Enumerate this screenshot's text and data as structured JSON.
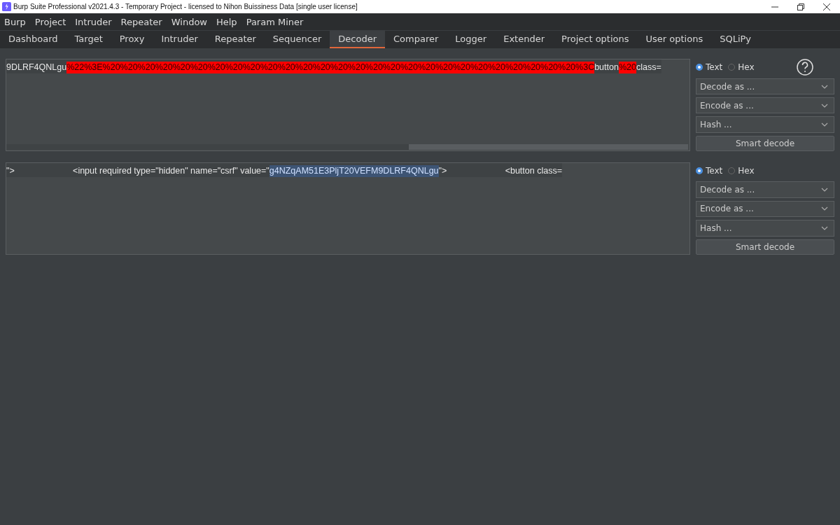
{
  "window": {
    "title": "Burp Suite Professional v2021.4.3 - Temporary Project - licensed to Nihon Buissiness Data [single user license]"
  },
  "menu": [
    "Burp",
    "Project",
    "Intruder",
    "Repeater",
    "Window",
    "Help",
    "Param Miner"
  ],
  "tabs": [
    {
      "label": "Dashboard",
      "selected": false
    },
    {
      "label": "Target",
      "selected": false
    },
    {
      "label": "Proxy",
      "selected": false
    },
    {
      "label": "Intruder",
      "selected": false
    },
    {
      "label": "Repeater",
      "selected": false
    },
    {
      "label": "Sequencer",
      "selected": false
    },
    {
      "label": "Decoder",
      "selected": true
    },
    {
      "label": "Comparer",
      "selected": false
    },
    {
      "label": "Logger",
      "selected": false
    },
    {
      "label": "Extender",
      "selected": false
    },
    {
      "label": "Project options",
      "selected": false
    },
    {
      "label": "User options",
      "selected": false
    },
    {
      "label": "SQLiPy",
      "selected": false
    }
  ],
  "panels": [
    {
      "segments": [
        {
          "text": "9DLRF4QNLgu",
          "kind": "plain"
        },
        {
          "text": "%22%3E%20%20%20%20%20%20%20%20%20%20%20%20%20%20%20%20%20%20%20%20%20%20%20%20%20%20%20%3C",
          "kind": "highlight"
        },
        {
          "text": "button",
          "kind": "plain"
        },
        {
          "text": "%20",
          "kind": "highlight"
        },
        {
          "text": "class=",
          "kind": "plain"
        }
      ],
      "scrollbar": true,
      "help": true,
      "modes": [
        {
          "label": "Text",
          "selected": true
        },
        {
          "label": "Hex",
          "selected": false
        }
      ],
      "selects": [
        "Decode as ...",
        "Encode as ...",
        "Hash ..."
      ],
      "button": "Smart decode"
    },
    {
      "segments": [
        {
          "text": "\">                        <input required type=\"hidden\" name=\"csrf\" value=\"",
          "kind": "plain"
        },
        {
          "text": "g4NZqAM51E3PljT20VEFM9DLRF4QNLgu",
          "kind": "selected"
        },
        {
          "text": "\">                        <button class=",
          "kind": "plain"
        }
      ],
      "scrollbar": false,
      "help": false,
      "modes": [
        {
          "label": "Text",
          "selected": true
        },
        {
          "label": "Hex",
          "selected": false
        }
      ],
      "selects": [
        "Decode as ...",
        "Encode as ...",
        "Hash ..."
      ],
      "button": "Smart decode"
    }
  ]
}
